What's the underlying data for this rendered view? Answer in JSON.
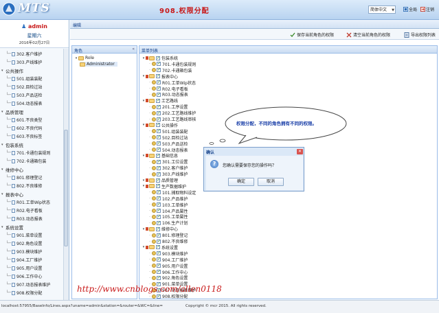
{
  "header": {
    "logo_text": "MTS",
    "page_title": "908.权限分配",
    "language": "简体中文",
    "fullscreen_label": "全局",
    "logout_label": "注销"
  },
  "user": {
    "name": "admin",
    "weekday": "星期六",
    "date": "2016年02月27日"
  },
  "sidebar": {
    "items": [
      {
        "type": "item",
        "label": "302.客户维护"
      },
      {
        "type": "item",
        "label": "303.产线维护"
      },
      {
        "type": "group",
        "label": "公共操作"
      },
      {
        "type": "item",
        "label": "501.组装装配"
      },
      {
        "type": "item",
        "label": "502.目检过站"
      },
      {
        "type": "item",
        "label": "503.产品送检"
      },
      {
        "type": "item",
        "label": "504.动态报表"
      },
      {
        "type": "group",
        "label": "品质管理"
      },
      {
        "type": "item",
        "label": "601.不良类型"
      },
      {
        "type": "item",
        "label": "602.不良代码"
      },
      {
        "type": "item",
        "label": "603.不良标签"
      },
      {
        "type": "group",
        "label": "包装系统"
      },
      {
        "type": "item",
        "label": "701.卡通包装规则"
      },
      {
        "type": "item",
        "label": "702.卡通箱包装"
      },
      {
        "type": "group",
        "label": "维修中心"
      },
      {
        "type": "item",
        "label": "801.修理登记"
      },
      {
        "type": "item",
        "label": "802.不良维修"
      },
      {
        "type": "group",
        "label": "报表中心"
      },
      {
        "type": "item",
        "label": "R01.工单Wip状态"
      },
      {
        "type": "item",
        "label": "R02.电子看板"
      },
      {
        "type": "item",
        "label": "R03.动态报表"
      },
      {
        "type": "group",
        "label": "系统设置"
      },
      {
        "type": "item",
        "label": "901.菜单设置"
      },
      {
        "type": "item",
        "label": "902.角色设置"
      },
      {
        "type": "item",
        "label": "903.模块维护"
      },
      {
        "type": "item",
        "label": "904.工厂维护"
      },
      {
        "type": "item",
        "label": "905.用户设置"
      },
      {
        "type": "item",
        "label": "906.工作中心"
      },
      {
        "type": "item",
        "label": "907.动态报表维护"
      },
      {
        "type": "item",
        "label": "908.权限分配"
      }
    ]
  },
  "main": {
    "crumb": "编辑",
    "toolbar": {
      "save_label": "保存当前角色的权限",
      "clear_label": "清空当前角色的权限",
      "export_label": "导出权限列表"
    },
    "role_panel": {
      "title": "角色",
      "root": "Role",
      "child": "Administrator"
    },
    "menu_panel": {
      "title": "菜单列表",
      "tree": [
        {
          "level": 0,
          "label": "包装系统"
        },
        {
          "level": 1,
          "label": "701.卡通包装规则"
        },
        {
          "level": 1,
          "label": "702.卡通箱包装"
        },
        {
          "level": 0,
          "label": "报表中心"
        },
        {
          "level": 1,
          "label": "R01.工单Wip状态"
        },
        {
          "level": 1,
          "label": "R02.电子看板"
        },
        {
          "level": 1,
          "label": "R03.动态报表"
        },
        {
          "level": 0,
          "label": "工艺路线"
        },
        {
          "level": 1,
          "label": "201.工序设置"
        },
        {
          "level": 1,
          "label": "202.工艺路线维护"
        },
        {
          "level": 1,
          "label": "203.工艺路线审核"
        },
        {
          "level": 0,
          "label": "公共操作"
        },
        {
          "level": 1,
          "label": "501.组装装配"
        },
        {
          "level": 1,
          "label": "502.目检过站"
        },
        {
          "level": 1,
          "label": "503.产品送检"
        },
        {
          "level": 1,
          "label": "504.动态报表"
        },
        {
          "level": 0,
          "label": "基础信息"
        },
        {
          "level": 1,
          "label": "301.工位设置"
        },
        {
          "level": 1,
          "label": "302.客户维护"
        },
        {
          "level": 1,
          "label": "303.产线维护"
        },
        {
          "level": 0,
          "label": "品质管理"
        },
        {
          "level": 0,
          "label": "生产数据维护"
        },
        {
          "level": 1,
          "label": "101.捕取物料设定"
        },
        {
          "level": 1,
          "label": "102.产品维护"
        },
        {
          "level": 1,
          "label": "103.工单维护"
        },
        {
          "level": 1,
          "label": "104.产品属性"
        },
        {
          "level": 1,
          "label": "105.工单属性"
        },
        {
          "level": 1,
          "label": "106.生产计划"
        },
        {
          "level": 0,
          "label": "维修中心"
        },
        {
          "level": 1,
          "label": "801.修理登记"
        },
        {
          "level": 1,
          "label": "802.不良维修"
        },
        {
          "level": 0,
          "label": "系统设置"
        },
        {
          "level": 1,
          "label": "903.模块维护"
        },
        {
          "level": 1,
          "label": "904.工厂维护"
        },
        {
          "level": 1,
          "label": "905.用户设置"
        },
        {
          "level": 1,
          "label": "906.工作中心"
        },
        {
          "level": 1,
          "label": "902.角色设置"
        },
        {
          "level": 1,
          "label": "901.菜单设置"
        },
        {
          "level": 1,
          "label": "907.动态报表维护"
        },
        {
          "level": 1,
          "label": "908.权限分配"
        }
      ]
    }
  },
  "callout": {
    "text": "权限分配，不同的角色拥有不同的权限。"
  },
  "dialog": {
    "title": "确认",
    "message": "您确认需要保存您的操作吗？",
    "ok_label": "确定",
    "cancel_label": "取消"
  },
  "watermark": "http://www.cnblogs.com/allen0118",
  "footer": {
    "status_url": "localhost:57955/BaseInfo/Lines.aspx?uname=admin&station=&router=&WC=&line=",
    "copyright": "Copyright © mcr 2015. All rights reserved."
  }
}
